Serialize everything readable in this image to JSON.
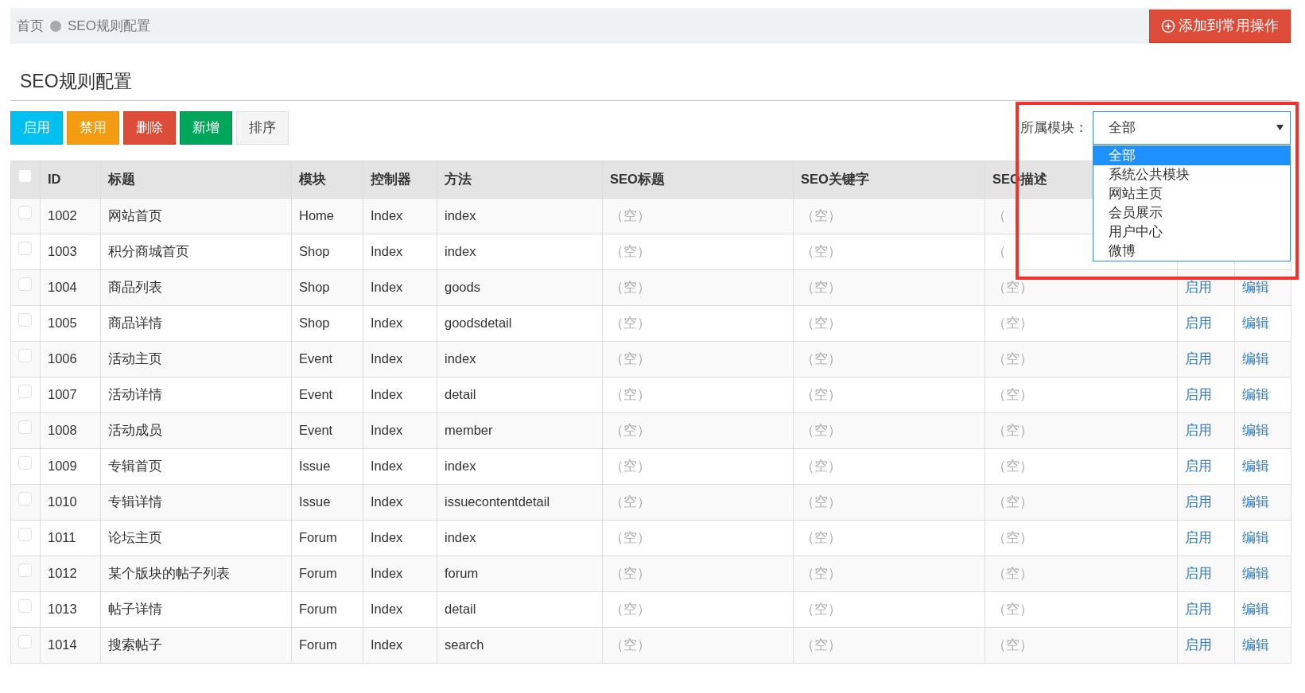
{
  "breadcrumb": {
    "items": [
      "首页",
      "SEO规则配置"
    ],
    "action_button": "添加到常用操作"
  },
  "page_title": "SEO规则配置",
  "toolbar": {
    "buttons": [
      {
        "label": "启用",
        "kind": "info"
      },
      {
        "label": "禁用",
        "kind": "warning"
      },
      {
        "label": "删除",
        "kind": "danger"
      },
      {
        "label": "新增",
        "kind": "success"
      },
      {
        "label": "排序",
        "kind": "default"
      }
    ]
  },
  "module_filter": {
    "label": "所属模块：",
    "value": "全部",
    "expanded": true,
    "options": [
      {
        "label": "全部",
        "selected": true
      },
      {
        "label": "系统公共模块",
        "selected": false
      },
      {
        "label": "网站主页",
        "selected": false
      },
      {
        "label": "会员展示",
        "selected": false
      },
      {
        "label": "用户中心",
        "selected": false
      },
      {
        "label": "微博",
        "selected": false
      }
    ]
  },
  "table": {
    "select_all_checked": false,
    "columns": [
      "ID",
      "标题",
      "模块",
      "控制器",
      "方法",
      "SEO标题",
      "SEO关键字",
      "SEO描述"
    ],
    "rows": [
      {
        "checked": false,
        "cells": [
          "1002",
          "网站首页",
          "Home",
          "Index",
          "index",
          "（空）",
          "（空）",
          "（"
        ],
        "actions": []
      },
      {
        "checked": false,
        "cells": [
          "1003",
          "积分商城首页",
          "Shop",
          "Index",
          "index",
          "（空）",
          "（空）",
          "（"
        ],
        "actions": []
      },
      {
        "checked": false,
        "cells": [
          "1004",
          "商品列表",
          "Shop",
          "Index",
          "goods",
          "（空）",
          "（空）",
          "（空）"
        ],
        "actions": [
          "启用",
          "编辑"
        ]
      },
      {
        "checked": false,
        "cells": [
          "1005",
          "商品详情",
          "Shop",
          "Index",
          "goodsdetail",
          "（空）",
          "（空）",
          "（空）"
        ],
        "actions": [
          "启用",
          "编辑"
        ]
      },
      {
        "checked": false,
        "cells": [
          "1006",
          "活动主页",
          "Event",
          "Index",
          "index",
          "（空）",
          "（空）",
          "（空）"
        ],
        "actions": [
          "启用",
          "编辑"
        ]
      },
      {
        "checked": false,
        "cells": [
          "1007",
          "活动详情",
          "Event",
          "Index",
          "detail",
          "（空）",
          "（空）",
          "（空）"
        ],
        "actions": [
          "启用",
          "编辑"
        ]
      },
      {
        "checked": false,
        "cells": [
          "1008",
          "活动成员",
          "Event",
          "Index",
          "member",
          "（空）",
          "（空）",
          "（空）"
        ],
        "actions": [
          "启用",
          "编辑"
        ]
      },
      {
        "checked": false,
        "cells": [
          "1009",
          "专辑首页",
          "Issue",
          "Index",
          "index",
          "（空）",
          "（空）",
          "（空）"
        ],
        "actions": [
          "启用",
          "编辑"
        ]
      },
      {
        "checked": false,
        "cells": [
          "1010",
          "专辑详情",
          "Issue",
          "Index",
          "issuecontentdetail",
          "（空）",
          "（空）",
          "（空）"
        ],
        "actions": [
          "启用",
          "编辑"
        ]
      },
      {
        "checked": false,
        "cells": [
          "1011",
          "论坛主页",
          "Forum",
          "Index",
          "index",
          "（空）",
          "（空）",
          "（空）"
        ],
        "actions": [
          "启用",
          "编辑"
        ]
      },
      {
        "checked": false,
        "cells": [
          "1012",
          "某个版块的帖子列表",
          "Forum",
          "Index",
          "forum",
          "（空）",
          "（空）",
          "（空）"
        ],
        "actions": [
          "启用",
          "编辑"
        ]
      },
      {
        "checked": false,
        "cells": [
          "1013",
          "帖子详情",
          "Forum",
          "Index",
          "detail",
          "（空）",
          "（空）",
          "（空）"
        ],
        "actions": [
          "启用",
          "编辑"
        ]
      },
      {
        "checked": false,
        "cells": [
          "1014",
          "搜索帖子",
          "Forum",
          "Index",
          "search",
          "（空）",
          "（空）",
          "（空）"
        ],
        "actions": [
          "启用",
          "编辑"
        ]
      }
    ]
  }
}
